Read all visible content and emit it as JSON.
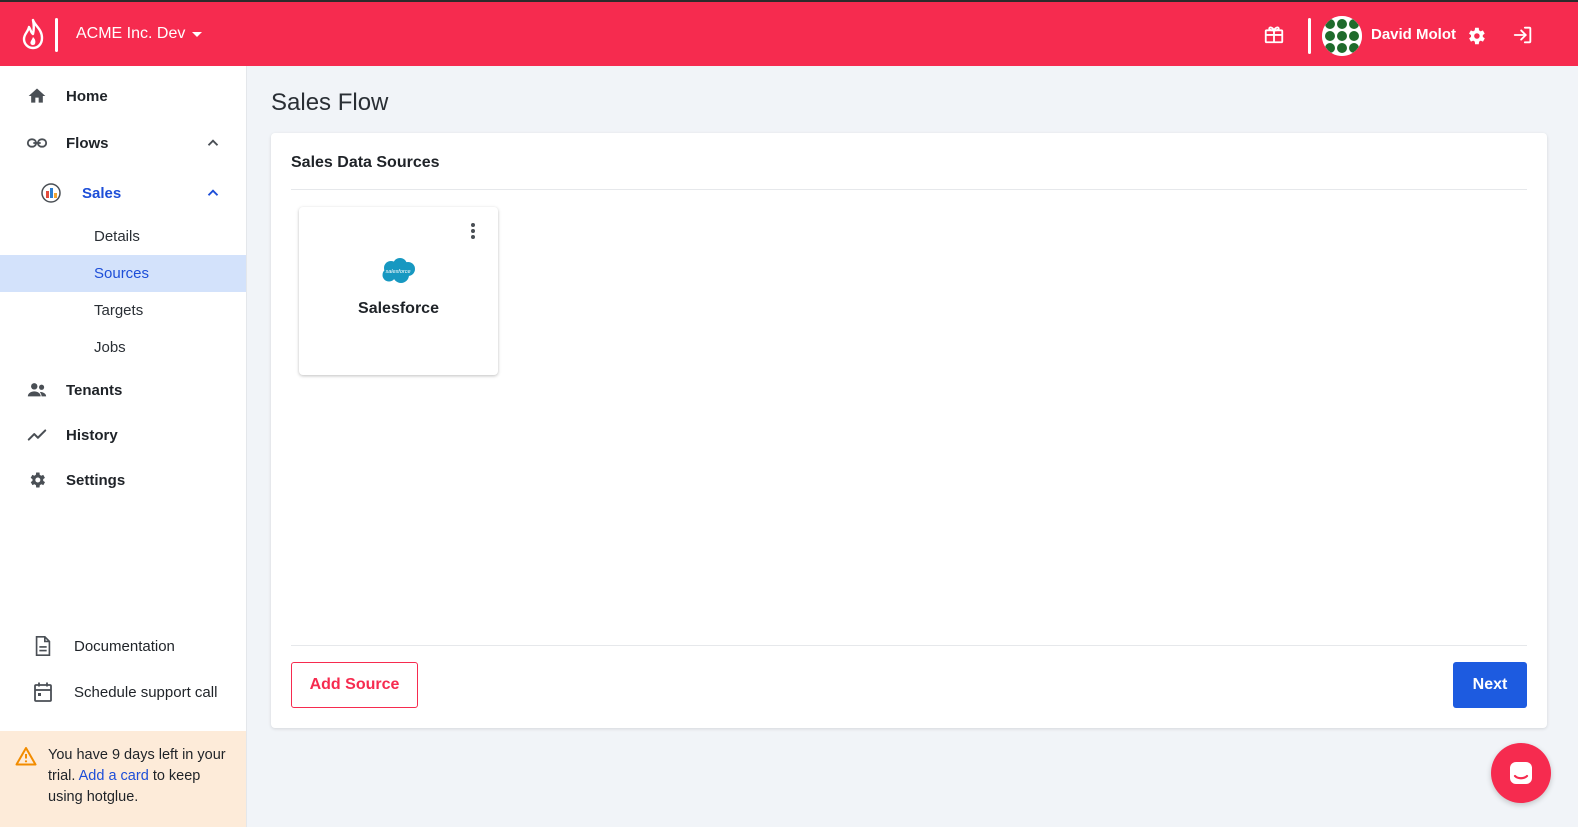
{
  "header": {
    "org_name": "ACME Inc. Dev",
    "user_name": "David Molot",
    "brand_color": "#f62b4f",
    "icons": [
      "flame-logo-icon",
      "gift-icon",
      "gear-icon",
      "logout-icon"
    ]
  },
  "sidebar": {
    "items": [
      {
        "label": "Home",
        "icon": "home-icon"
      },
      {
        "label": "Flows",
        "icon": "link-icon",
        "expanded": true
      },
      {
        "label": "Sales",
        "icon": "flow-logo-icon",
        "expanded": true,
        "active": true
      },
      {
        "label": "Details"
      },
      {
        "label": "Sources",
        "selected": true
      },
      {
        "label": "Targets"
      },
      {
        "label": "Jobs"
      },
      {
        "label": "Tenants",
        "icon": "people-icon"
      },
      {
        "label": "History",
        "icon": "trend-icon"
      },
      {
        "label": "Settings",
        "icon": "gear-icon"
      }
    ],
    "footer": [
      {
        "label": "Documentation",
        "icon": "document-icon"
      },
      {
        "label": "Schedule support call",
        "icon": "calendar-icon"
      }
    ],
    "trial": {
      "text_before": "You have 9 days left in your trial.",
      "link": "Add a card",
      "text_after": "to keep using hotglue."
    }
  },
  "main": {
    "page_title": "Sales Flow",
    "card_title": "Sales Data Sources",
    "sources": [
      {
        "name": "Salesforce",
        "logo_text": "salesforce",
        "logo_color": "#1798c1"
      }
    ],
    "add_button": "Add Source",
    "next_button": "Next",
    "next_color": "#1d5be0"
  }
}
